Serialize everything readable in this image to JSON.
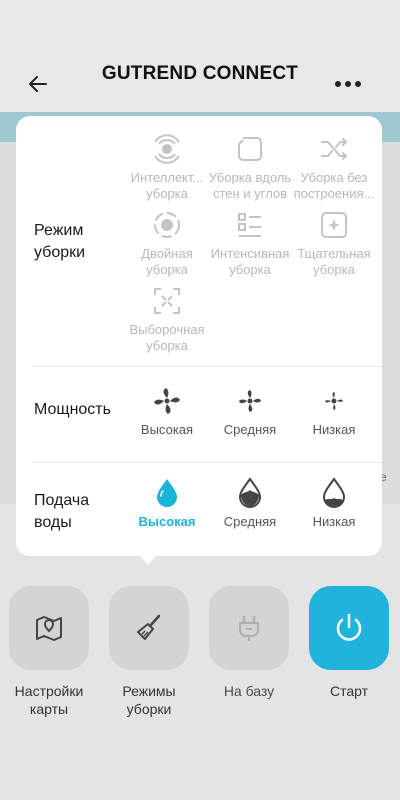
{
  "header": {
    "title": "GUTREND CONNECT",
    "back_icon": "arrow-left-icon",
    "more_icon": "more-dots-icon"
  },
  "popup": {
    "cleaning_mode": {
      "label": "Режим\nуборки",
      "options": [
        {
          "label": "Интеллект...\nуборка",
          "icon": "smart-clean-icon",
          "enabled": false
        },
        {
          "label": "Уборка вдоль\nстен и углов",
          "icon": "edge-clean-icon",
          "enabled": false
        },
        {
          "label": "Уборка без\nпостроения...",
          "icon": "shuffle-icon",
          "enabled": false
        },
        {
          "label": "Двойная\nуборка",
          "icon": "double-clean-icon",
          "enabled": false
        },
        {
          "label": "Интенсивная\nуборка",
          "icon": "intensive-clean-icon",
          "enabled": false
        },
        {
          "label": "Тщательная\nуборка",
          "icon": "thorough-clean-icon",
          "enabled": false
        },
        {
          "label": "Выборочная\nуборка",
          "icon": "selective-clean-icon",
          "enabled": false
        }
      ]
    },
    "power": {
      "label": "Мощность",
      "options": [
        {
          "label": "Высокая",
          "icon": "fan-high-icon",
          "selected": false
        },
        {
          "label": "Средняя",
          "icon": "fan-medium-icon",
          "selected": false
        },
        {
          "label": "Низкая",
          "icon": "fan-low-icon",
          "selected": false
        }
      ]
    },
    "water": {
      "label": "Подача\nводы",
      "options": [
        {
          "label": "Высокая",
          "icon": "water-high-icon",
          "selected": true
        },
        {
          "label": "Средняя",
          "icon": "water-medium-icon",
          "selected": false
        },
        {
          "label": "Низкая",
          "icon": "water-low-icon",
          "selected": false
        }
      ]
    }
  },
  "bottom_bar": [
    {
      "label": "Настройки\nкарты",
      "icon": "map-pin-icon"
    },
    {
      "label": "Режимы\nуборки",
      "icon": "broom-icon"
    },
    {
      "label": "На базу",
      "icon": "dock-icon"
    },
    {
      "label": "Старт",
      "icon": "power-icon"
    }
  ],
  "colors": {
    "accent": "#19b5d9",
    "start_button": "#21b3dc",
    "disabled_text": "#b8b8b8"
  }
}
